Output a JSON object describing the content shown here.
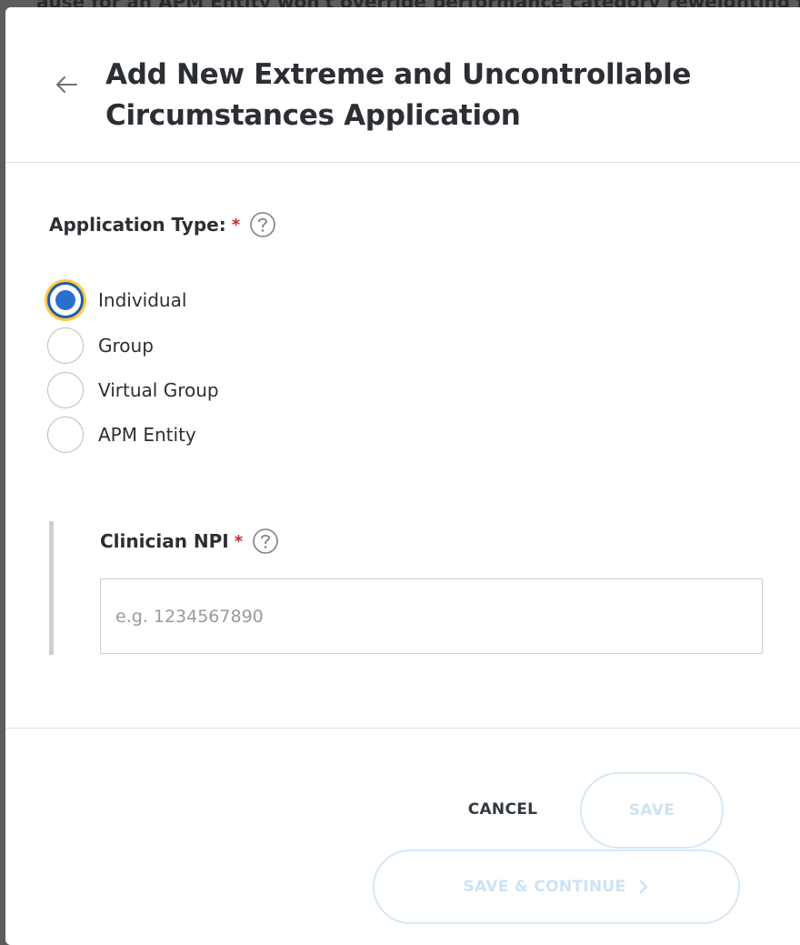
{
  "backdrop": {
    "partial_text": "ause for an APM Entity won't override performance category reweighting for"
  },
  "modal": {
    "title": "Add New Extreme and Uncontrollable Circumstances Application",
    "application_type": {
      "label": "Application Type:",
      "required_mark": "*",
      "options": [
        {
          "label": "Individual",
          "selected": true
        },
        {
          "label": "Group",
          "selected": false
        },
        {
          "label": "Virtual Group",
          "selected": false
        },
        {
          "label": "APM Entity",
          "selected": false
        }
      ]
    },
    "clinician_npi": {
      "label": "Clinician NPI",
      "required_mark": "*",
      "placeholder": "e.g. 1234567890",
      "value": ""
    },
    "footer": {
      "cancel_label": "CANCEL",
      "save_label": "SAVE",
      "save_continue_label": "SAVE & CONTINUE"
    }
  },
  "icons": {
    "back": "arrow-left-icon",
    "help": "question-circle-icon",
    "chevron": "chevron-right-icon"
  },
  "colors": {
    "accent": "#2a6fd0",
    "focus_ring": "#ffc940",
    "required": "#c62828",
    "disabled_button_text": "#cde3f3"
  }
}
